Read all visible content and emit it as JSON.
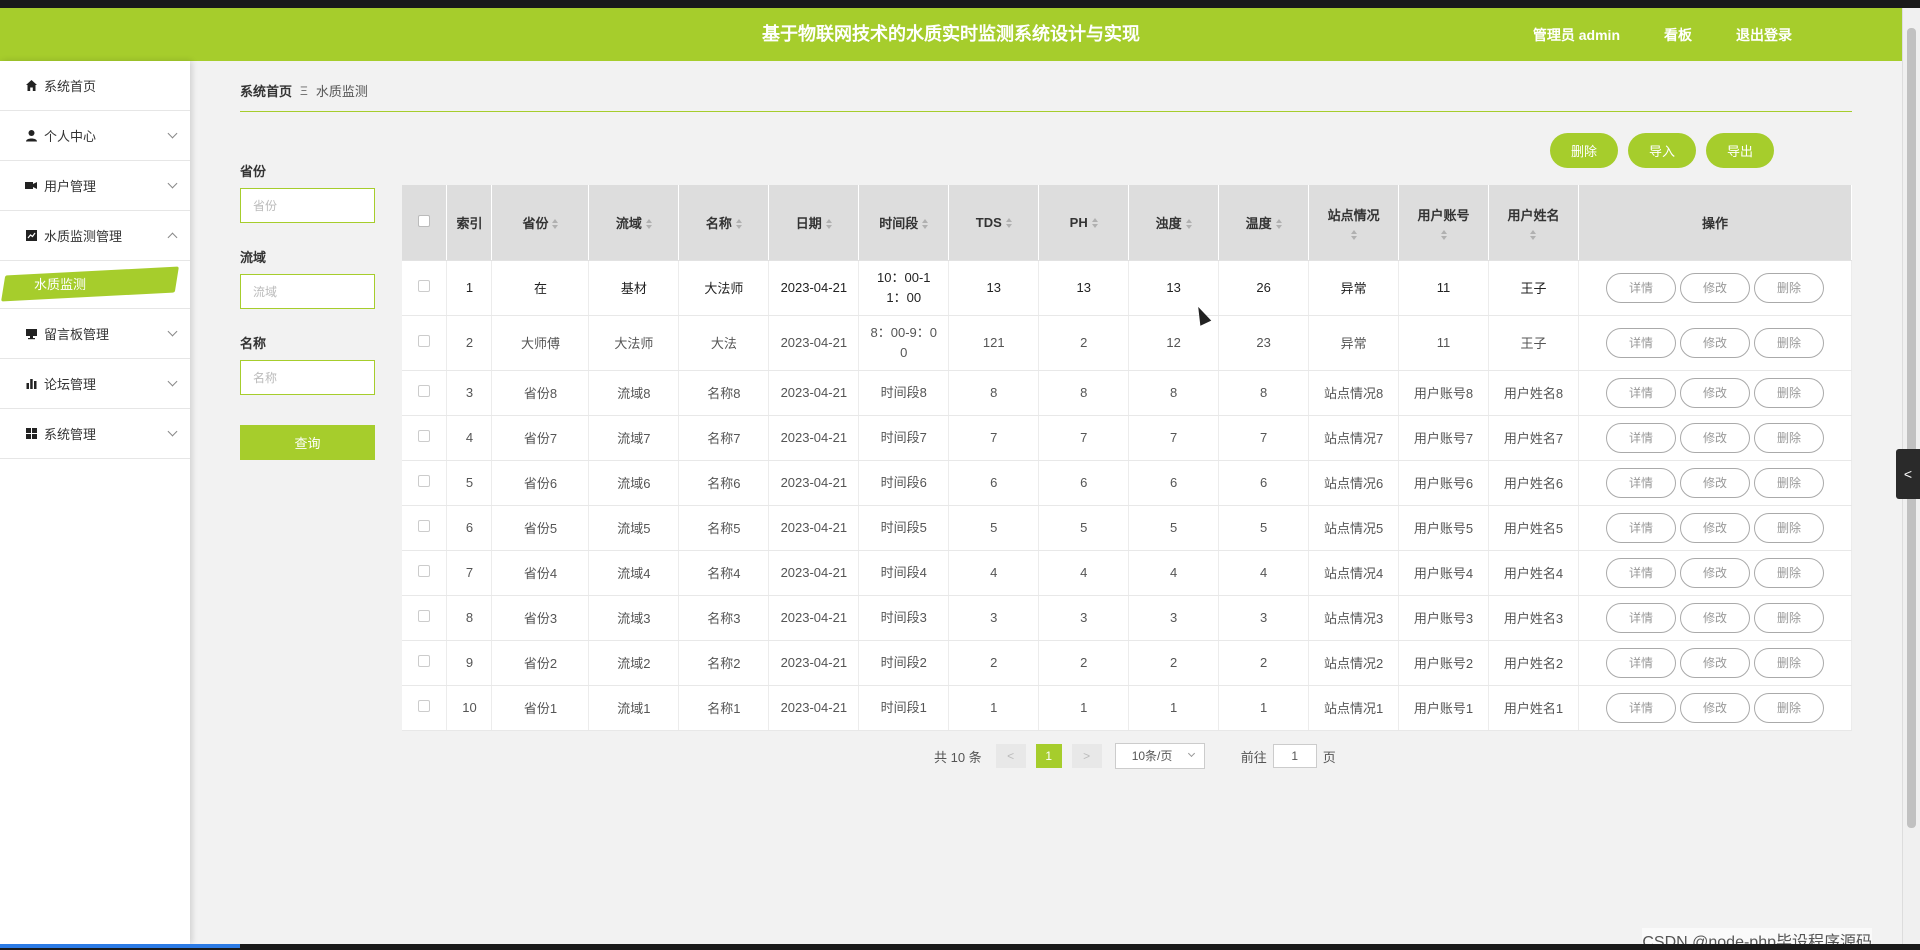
{
  "header": {
    "title": "基于物联网技术的水质实时监测系统设计与实现",
    "user_label": "管理员 admin",
    "board_label": "看板",
    "logout_label": "退出登录"
  },
  "sidebar": {
    "items": [
      {
        "label": "系统首页",
        "icon": "home-icon",
        "expandable": false
      },
      {
        "label": "个人中心",
        "icon": "user-icon",
        "expandable": true
      },
      {
        "label": "用户管理",
        "icon": "users-icon",
        "expandable": true
      },
      {
        "label": "水质监测管理",
        "icon": "chart-icon",
        "expandable": true,
        "expanded": true
      },
      {
        "label": "留言板管理",
        "icon": "monitor-icon",
        "expandable": true
      },
      {
        "label": "论坛管理",
        "icon": "bar-chart-icon",
        "expandable": true
      },
      {
        "label": "系统管理",
        "icon": "grid-icon",
        "expandable": true
      }
    ],
    "active_sub": "水质监测"
  },
  "breadcrumb": {
    "home": "系统首页",
    "separator": "Ξ",
    "current": "水质监测"
  },
  "filter": {
    "province_label": "省份",
    "province_placeholder": "省份",
    "basin_label": "流域",
    "basin_placeholder": "流域",
    "name_label": "名称",
    "name_placeholder": "名称",
    "query_label": "查询"
  },
  "actions": {
    "delete_label": "删除",
    "import_label": "导入",
    "export_label": "导出"
  },
  "table": {
    "headers": [
      "索引",
      "省份",
      "流域",
      "名称",
      "日期",
      "时间段",
      "TDS",
      "PH",
      "浊度",
      "温度",
      "站点情况",
      "用户账号",
      "用户姓名",
      "操作"
    ],
    "op_labels": [
      "详情",
      "修改",
      "删除"
    ],
    "rows": [
      {
        "index": "1",
        "province": "在",
        "basin": "基材",
        "name": "大法师",
        "date": "2023-04-21",
        "period_l1": "10：00-1",
        "period_l2": "1：00",
        "tds": "13",
        "ph": "13",
        "turbidity": "13",
        "temp": "26",
        "site": "异常",
        "account": "11",
        "username": "王子"
      },
      {
        "index": "2",
        "province": "大师傅",
        "basin": "大法师",
        "name": "大法",
        "date": "2023-04-21",
        "period_l1": "8：00-9：0",
        "period_l2": "0",
        "tds": "121",
        "ph": "2",
        "turbidity": "12",
        "temp": "23",
        "site": "异常",
        "account": "11",
        "username": "王子"
      },
      {
        "index": "3",
        "province": "省份8",
        "basin": "流域8",
        "name": "名称8",
        "date": "2023-04-21",
        "period_l1": "时间段8",
        "period_l2": "",
        "tds": "8",
        "ph": "8",
        "turbidity": "8",
        "temp": "8",
        "site": "站点情况8",
        "account": "用户账号8",
        "username": "用户姓名8"
      },
      {
        "index": "4",
        "province": "省份7",
        "basin": "流域7",
        "name": "名称7",
        "date": "2023-04-21",
        "period_l1": "时间段7",
        "period_l2": "",
        "tds": "7",
        "ph": "7",
        "turbidity": "7",
        "temp": "7",
        "site": "站点情况7",
        "account": "用户账号7",
        "username": "用户姓名7"
      },
      {
        "index": "5",
        "province": "省份6",
        "basin": "流域6",
        "name": "名称6",
        "date": "2023-04-21",
        "period_l1": "时间段6",
        "period_l2": "",
        "tds": "6",
        "ph": "6",
        "turbidity": "6",
        "temp": "6",
        "site": "站点情况6",
        "account": "用户账号6",
        "username": "用户姓名6"
      },
      {
        "index": "6",
        "province": "省份5",
        "basin": "流域5",
        "name": "名称5",
        "date": "2023-04-21",
        "period_l1": "时间段5",
        "period_l2": "",
        "tds": "5",
        "ph": "5",
        "turbidity": "5",
        "temp": "5",
        "site": "站点情况5",
        "account": "用户账号5",
        "username": "用户姓名5"
      },
      {
        "index": "7",
        "province": "省份4",
        "basin": "流域4",
        "name": "名称4",
        "date": "2023-04-21",
        "period_l1": "时间段4",
        "period_l2": "",
        "tds": "4",
        "ph": "4",
        "turbidity": "4",
        "temp": "4",
        "site": "站点情况4",
        "account": "用户账号4",
        "username": "用户姓名4"
      },
      {
        "index": "8",
        "province": "省份3",
        "basin": "流域3",
        "name": "名称3",
        "date": "2023-04-21",
        "period_l1": "时间段3",
        "period_l2": "",
        "tds": "3",
        "ph": "3",
        "turbidity": "3",
        "temp": "3",
        "site": "站点情况3",
        "account": "用户账号3",
        "username": "用户姓名3"
      },
      {
        "index": "9",
        "province": "省份2",
        "basin": "流域2",
        "name": "名称2",
        "date": "2023-04-21",
        "period_l1": "时间段2",
        "period_l2": "",
        "tds": "2",
        "ph": "2",
        "turbidity": "2",
        "temp": "2",
        "site": "站点情况2",
        "account": "用户账号2",
        "username": "用户姓名2"
      },
      {
        "index": "10",
        "province": "省份1",
        "basin": "流域1",
        "name": "名称1",
        "date": "2023-04-21",
        "period_l1": "时间段1",
        "period_l2": "",
        "tds": "1",
        "ph": "1",
        "turbidity": "1",
        "temp": "1",
        "site": "站点情况1",
        "account": "用户账号1",
        "username": "用户姓名1"
      }
    ]
  },
  "pagination": {
    "total_text": "共 10 条",
    "prev": "<",
    "current_page": "1",
    "next": ">",
    "page_size": "10条/页",
    "goto_label": "前往",
    "goto_value": "1",
    "page_suffix": "页"
  },
  "side_tab_label": "<",
  "watermark": "CSDN @node-php毕设程序源码",
  "colors": {
    "accent": "#a6cd2c",
    "header_text": "#ffffff",
    "table_header_bg": "#dddddd"
  }
}
